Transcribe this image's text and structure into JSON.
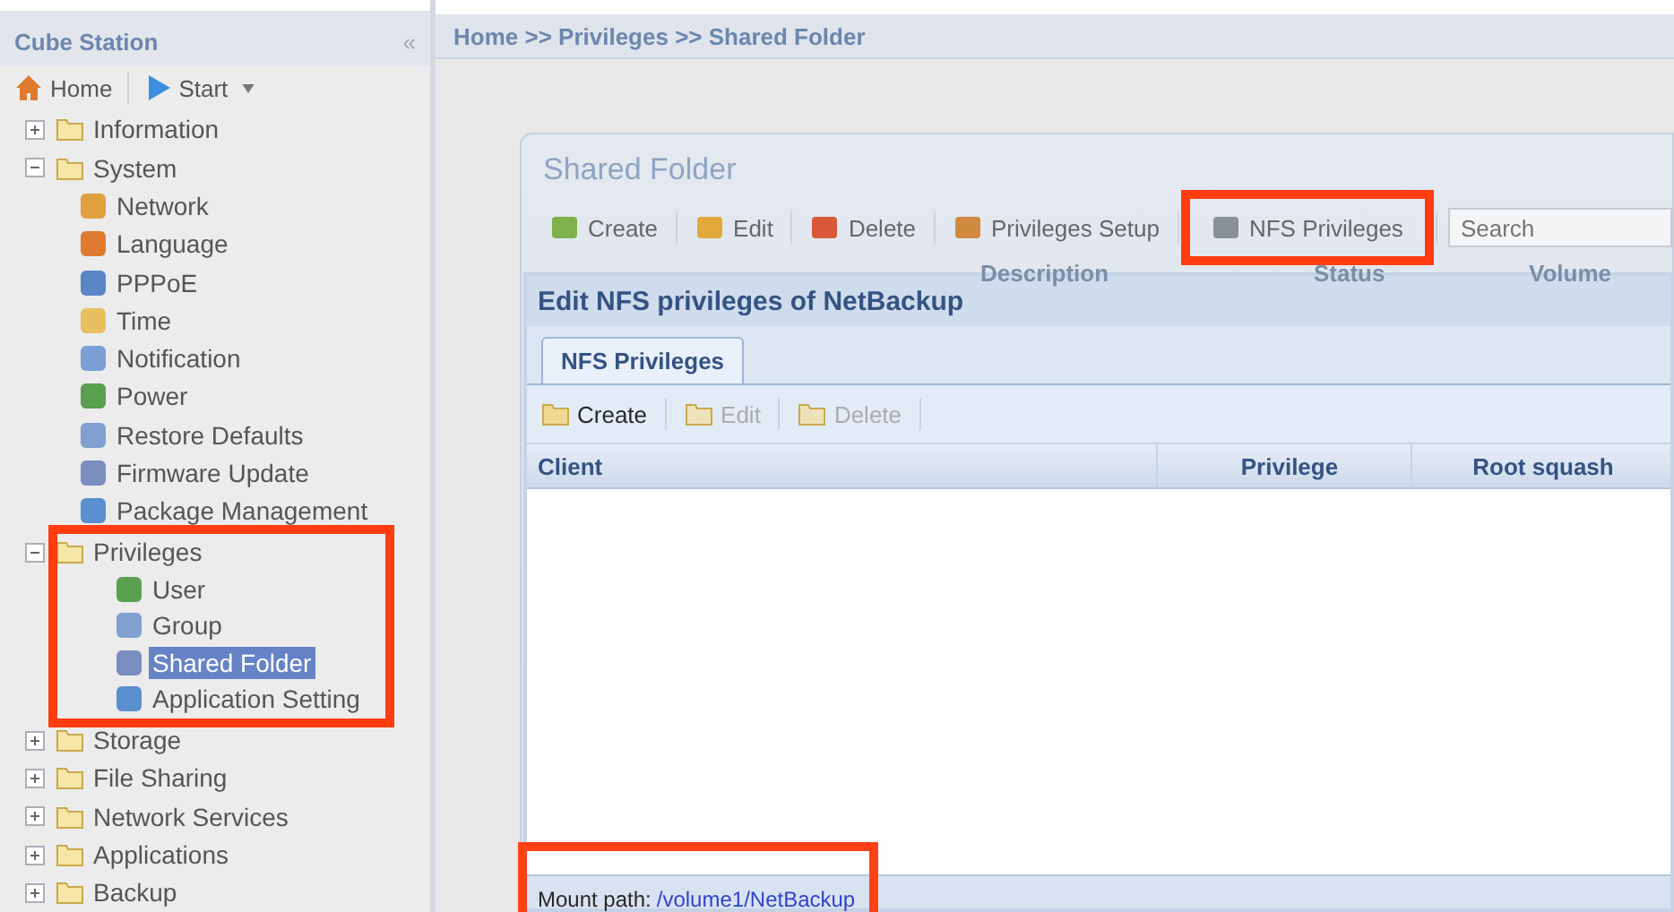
{
  "sidebar": {
    "title": "Cube Station",
    "collapse": "«",
    "toolbar": [
      {
        "label": "Home",
        "kind": "home"
      },
      {
        "label": "Start",
        "kind": "start"
      }
    ],
    "tree": [
      {
        "label": "Information",
        "expanded": false,
        "highlighted": false,
        "selected": false
      },
      {
        "label": "System",
        "expanded": true,
        "highlighted": false,
        "selected": false,
        "children": [
          {
            "label": "Network",
            "selected": false
          },
          {
            "label": "Language",
            "selected": false
          },
          {
            "label": "PPPoE",
            "selected": false
          },
          {
            "label": "Time",
            "selected": false
          },
          {
            "label": "Notification",
            "selected": false
          },
          {
            "label": "Power",
            "selected": false
          },
          {
            "label": "Restore Defaults",
            "selected": false
          },
          {
            "label": "Firmware Update",
            "selected": false
          },
          {
            "label": "Package Management",
            "selected": false
          }
        ]
      },
      {
        "label": "Privileges",
        "expanded": true,
        "highlighted": true,
        "selected": false,
        "children": [
          {
            "label": "User",
            "selected": false
          },
          {
            "label": "Group",
            "selected": false
          },
          {
            "label": "Shared Folder",
            "selected": true
          },
          {
            "label": "Application Setting",
            "selected": false
          }
        ]
      },
      {
        "label": "Storage",
        "expanded": false,
        "highlighted": false,
        "selected": false
      },
      {
        "label": "File Sharing",
        "expanded": false,
        "highlighted": false,
        "selected": false
      },
      {
        "label": "Network Services",
        "expanded": false,
        "highlighted": false,
        "selected": false
      },
      {
        "label": "Applications",
        "expanded": false,
        "highlighted": false,
        "selected": false
      },
      {
        "label": "Backup",
        "expanded": false,
        "highlighted": false,
        "selected": false
      }
    ]
  },
  "breadcrumb": "Home >> Privileges >> Shared Folder",
  "window": {
    "title": "Shared Folder",
    "toolbar": [
      {
        "label": "Create",
        "highlighted": false
      },
      {
        "label": "Edit",
        "highlighted": false
      },
      {
        "label": "Delete",
        "highlighted": false
      },
      {
        "label": "Privileges Setup",
        "highlighted": false
      },
      {
        "label": "NFS Privileges",
        "highlighted": true
      }
    ],
    "search": {
      "placeholder": "Search"
    },
    "columns": [
      "Description",
      "Status",
      "Volume"
    ]
  },
  "dialog": {
    "title": "Edit NFS privileges of NetBackup",
    "tabs": [
      {
        "label": "NFS Privileges",
        "selected": true
      }
    ],
    "toolbar": [
      {
        "label": "Create",
        "disabled": false
      },
      {
        "label": "Edit",
        "disabled": true
      },
      {
        "label": "Delete",
        "disabled": true
      }
    ],
    "columns": [
      "Client",
      "Privilege",
      "Root squash"
    ],
    "mount_path": {
      "label": "Mount path:",
      "value": "/volume1/NetBackup",
      "highlighted": true
    }
  }
}
